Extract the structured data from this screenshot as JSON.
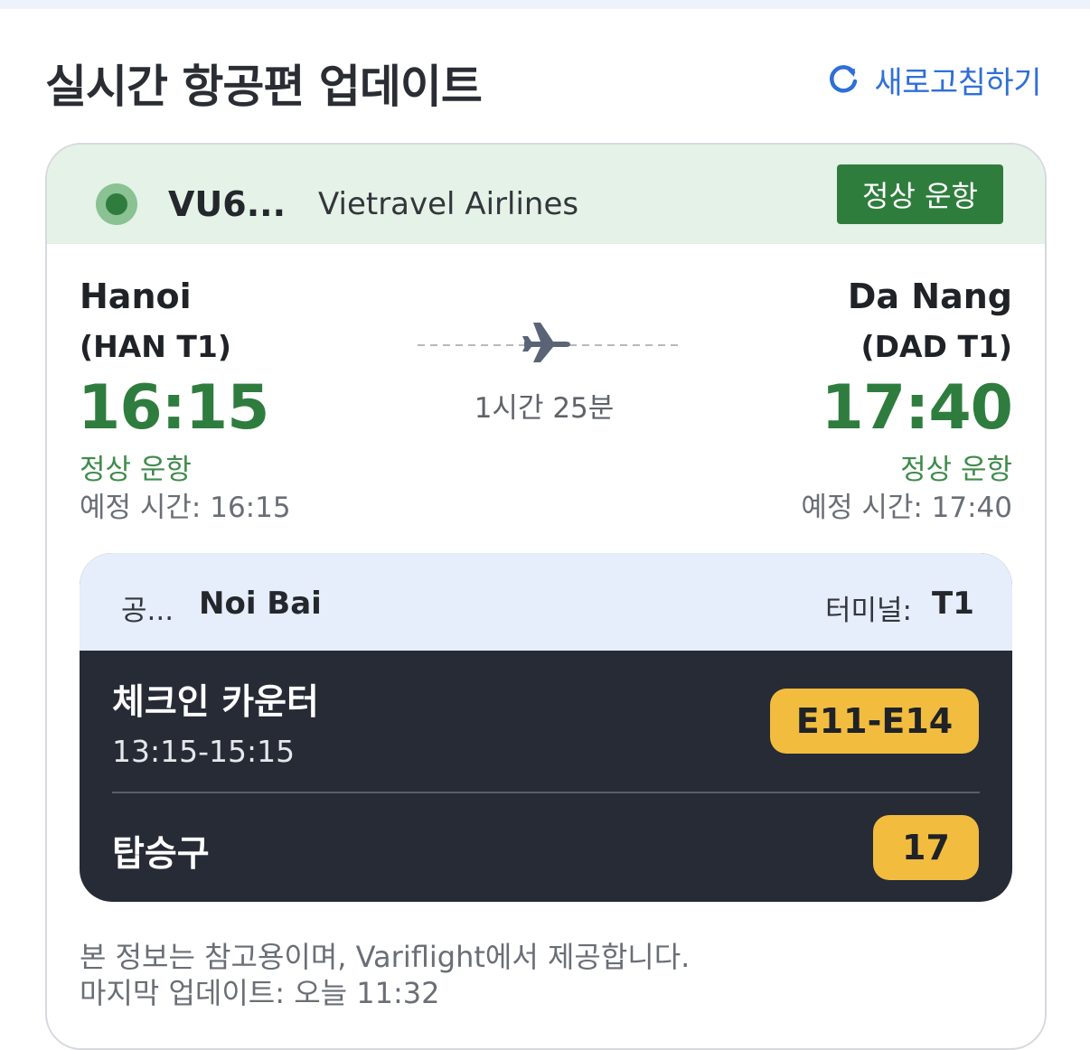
{
  "header": {
    "title": "실시간 항공편 업데이트",
    "refresh_label": "새로고침하기",
    "refresh_icon": "refresh-icon"
  },
  "flight": {
    "number": "VU6...",
    "airline": "Vietravel Airlines",
    "status": "정상 운항",
    "status_color": "#2f7d3d"
  },
  "departure": {
    "city": "Hanoi",
    "code": "(HAN T1)",
    "time": "16:15",
    "status": "정상 운항",
    "scheduled": "예정 시간: 16:15"
  },
  "arrival": {
    "city": "Da Nang",
    "code": "(DAD T1)",
    "time": "17:40",
    "status": "정상 운항",
    "scheduled": "예정 시간: 17:40"
  },
  "route": {
    "duration": "1시간 25분",
    "icon": "airplane-icon"
  },
  "airport_info": {
    "airport_label": "공...",
    "airport_name": "Noi Bai",
    "terminal_label": "터미널:",
    "terminal_value": "T1",
    "checkin_label": "체크인 카운터",
    "checkin_time": "13:15-15:15",
    "checkin_counters": "E11-E14",
    "gate_label": "탑승구",
    "gate_value": "17",
    "badge_color": "#f2bc3f"
  },
  "footer": {
    "source_note": "본 정보는 참고용이며, Variflight에서 제공합니다.",
    "last_updated": "마지막 업데이트: 오늘 11:32"
  }
}
